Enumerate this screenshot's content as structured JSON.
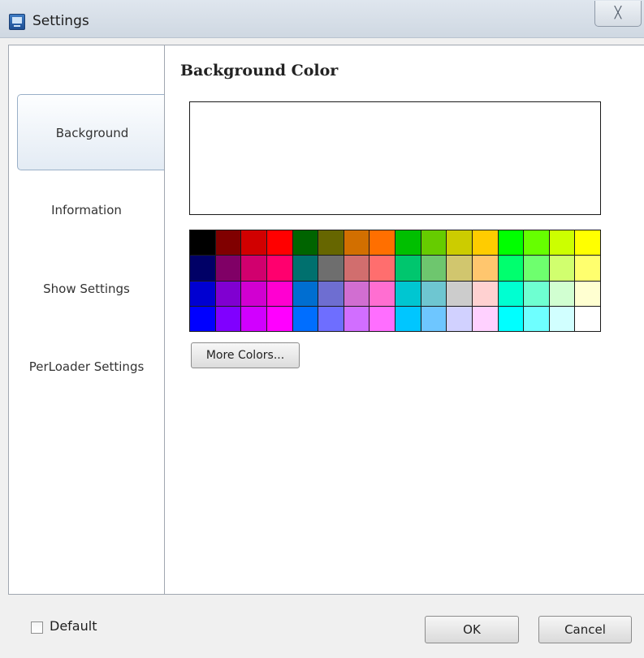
{
  "window": {
    "title": "Settings",
    "close_glyph": "╳"
  },
  "nav": {
    "items": [
      {
        "label": "Background",
        "active": true
      },
      {
        "label": "Information",
        "active": false
      },
      {
        "label": "Show Settings",
        "active": false
      },
      {
        "label": "PerLoader Settings",
        "active": false
      }
    ]
  },
  "content": {
    "section_title": "Background Color",
    "preview_color": "#ffffff",
    "more_colors_label": "More Colors..."
  },
  "palette": {
    "rows": [
      [
        "#000000",
        "#800000",
        "#d10000",
        "#ff0000",
        "#006400",
        "#666600",
        "#d26f00",
        "#ff6f00",
        "#00bf00",
        "#66cc00",
        "#cccc00",
        "#ffcc00",
        "#00ff00",
        "#66ff00",
        "#ccff00",
        "#ffff00"
      ],
      [
        "#000066",
        "#800066",
        "#d1006e",
        "#ff006e",
        "#00706e",
        "#6e6e6e",
        "#d16e6e",
        "#ff6e6e",
        "#00c66e",
        "#6ec66e",
        "#d1c66e",
        "#ffc66e",
        "#00ff6e",
        "#6eff6e",
        "#d1ff6e",
        "#ffff6e"
      ],
      [
        "#0000d1",
        "#8000d1",
        "#d100d1",
        "#ff00d1",
        "#006ed1",
        "#6e6ed1",
        "#d16ed1",
        "#ff6ed1",
        "#00c6d1",
        "#6ec6d1",
        "#cccccc",
        "#ffd1d1",
        "#00ffd1",
        "#6effd1",
        "#d1ffd1",
        "#ffffd1"
      ],
      [
        "#0000ff",
        "#8000ff",
        "#d100ff",
        "#ff00ff",
        "#006eff",
        "#6e6eff",
        "#d16eff",
        "#ff6eff",
        "#00c6ff",
        "#6ec6ff",
        "#d1d1ff",
        "#ffd1ff",
        "#00ffff",
        "#6effff",
        "#d1ffff",
        "#ffffff"
      ]
    ]
  },
  "footer": {
    "default_label": "Default",
    "default_checked": false,
    "ok_label": "OK",
    "cancel_label": "Cancel"
  }
}
